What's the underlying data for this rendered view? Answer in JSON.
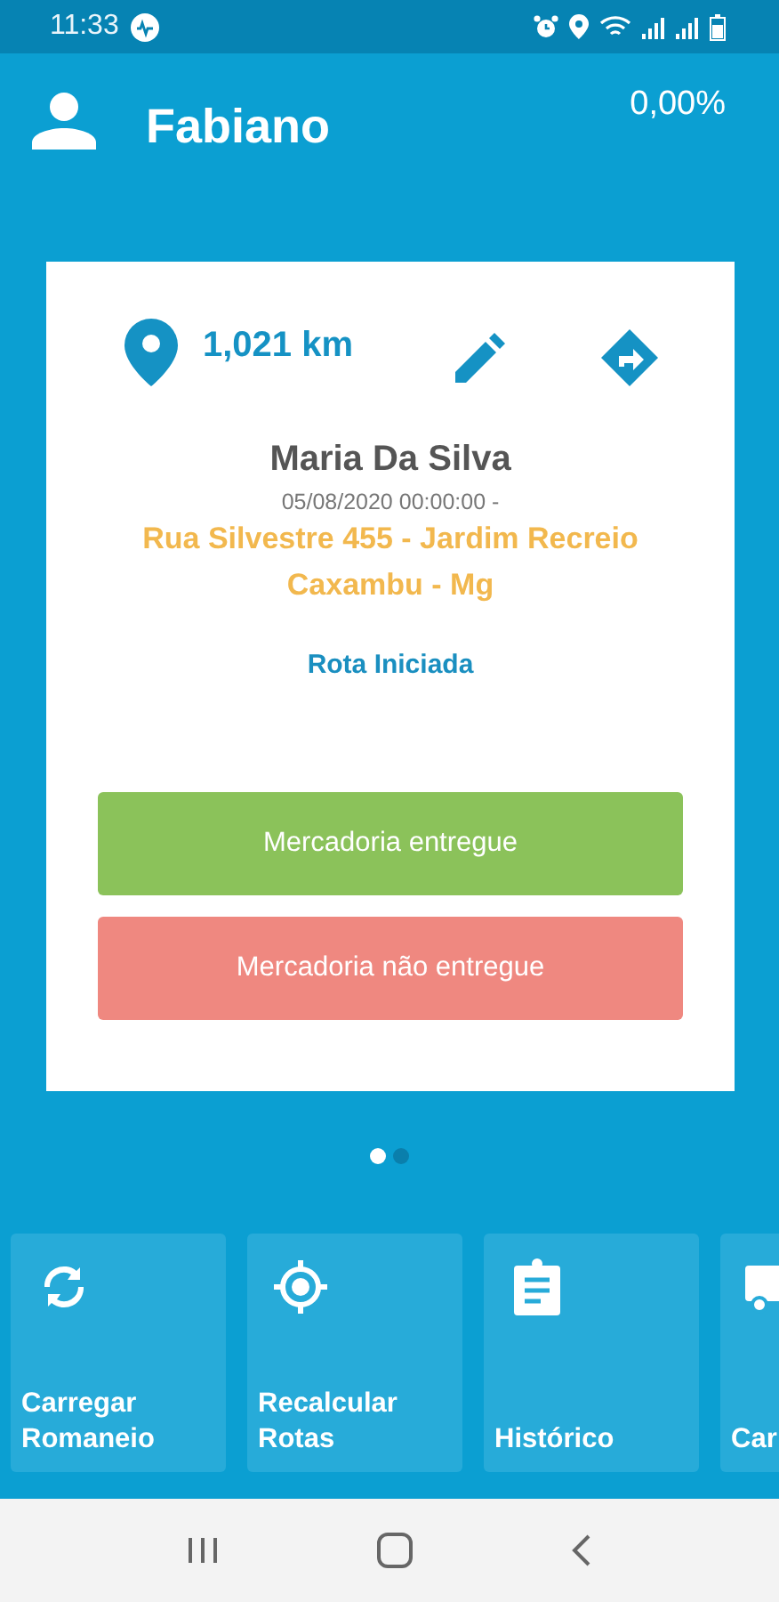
{
  "status_bar": {
    "time": "11:33"
  },
  "header": {
    "user_name": "Fabiano",
    "percentage": "0,00%"
  },
  "delivery_card": {
    "distance": "1,021 km",
    "customer": "Maria Da Silva",
    "datetime": "05/08/2020 00:00:00 -",
    "address_lines": [
      "Rua Silvestre 455 - Jardim Recreio",
      "Caxambu - Mg"
    ],
    "status": "Rota Iniciada",
    "buttons": [
      {
        "kind": "delivered",
        "label": "Mercadoria entregue"
      },
      {
        "kind": "not_delivered",
        "label": "Mercadoria não entregue"
      }
    ]
  },
  "pager": [
    {
      "selected": true
    },
    {
      "selected": false
    }
  ],
  "tiles": [
    {
      "kind": "sync",
      "label": "Carregar Romaneio"
    },
    {
      "kind": "target",
      "label": "Recalcular Rotas"
    },
    {
      "kind": "clipboard",
      "label": "Histórico"
    },
    {
      "kind": "truck",
      "label": "Car"
    }
  ]
}
